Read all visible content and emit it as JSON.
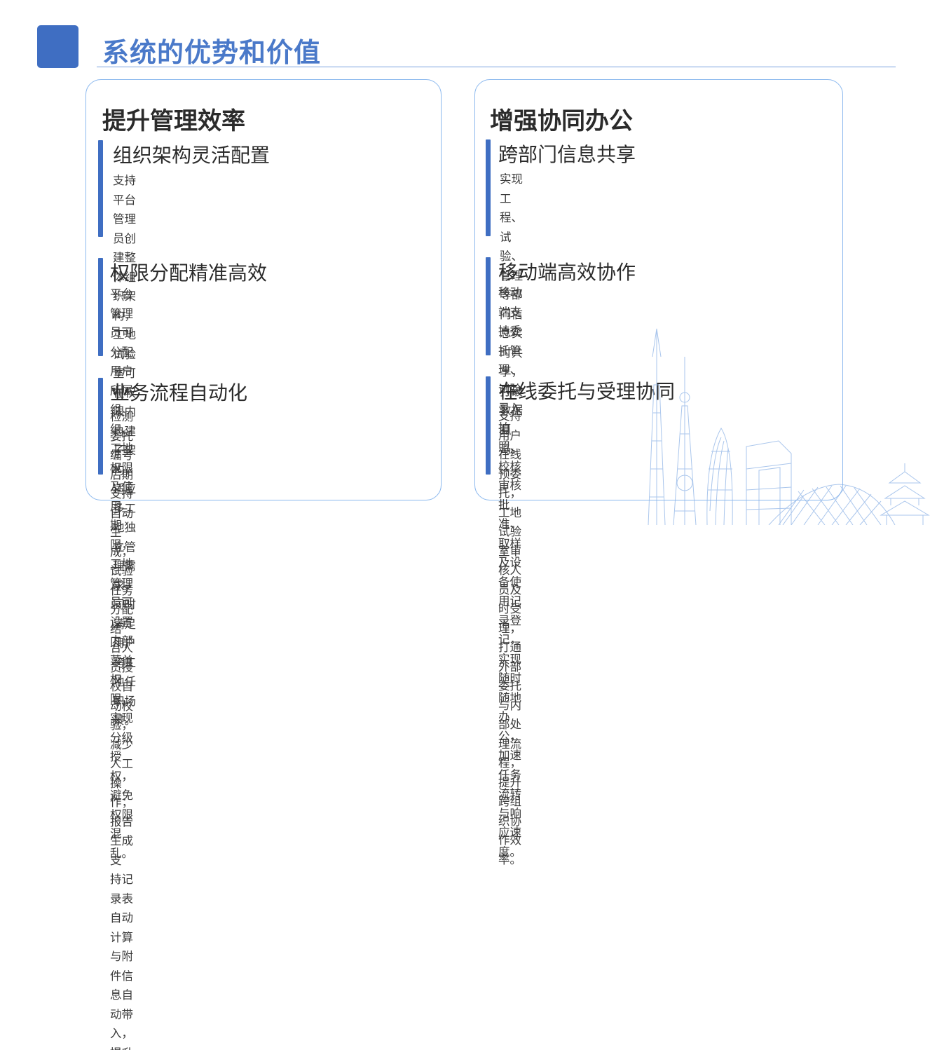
{
  "page": {
    "title": "系统的优势和价值"
  },
  "left_card": {
    "heading": "提升管理效率",
    "items": [
      {
        "title": "组织架构灵活配置",
        "lines": [
          "支持平台管理员创建整体组织架构，工地试验室可在权",
          "限内自建子架构，适应多工地独立管理需求，同时满足",
          "用户跨工地任职场景。"
        ]
      },
      {
        "title": "权限分配精准高效",
        "lines": [
          "平台管理员可分配用户所属组织、工地权限及使用",
          "期限，工地管理员可设置内部菜单权限，实现分级",
          "授权，避免权限混乱。"
        ]
      },
      {
        "title": "业务流程自动化",
        "lines": [
          "检测委托编号后期支持自动生成，试验任务分配结",
          "合人员授权自动校验，减少人工操作；报告生成支",
          "持记录表自动计算与附件信息自动带入，提升效率。"
        ]
      }
    ]
  },
  "right_card": {
    "heading": "增强协同办公",
    "items": [
      {
        "title": "跨部门信息共享",
        "lines": [
          "实现工程、试验、管理等部门信息实时共享，打破数据孤",
          "岛。"
        ]
      },
      {
        "title": "移动端高效协作",
        "lines": [
          "移动端支持委托管理、试验录入拍照、校核审核批准、",
          "取样及设备使用记录登记，实现随时随地办公，加速",
          "任务流转与响应速度。"
        ]
      },
      {
        "title": "在线委托与受理协同",
        "lines": [
          "支持用户在线预委托，工地试验室审核人员及时受理，",
          "打通外部委托与内部处理流程，提升跨组织协作效率。"
        ]
      }
    ]
  },
  "colors": {
    "accent": "#3f6ec2",
    "title": "#4a79c9",
    "card_border": "#8bb8ee"
  },
  "decoration": {
    "icon": "city-skyline-icon"
  }
}
